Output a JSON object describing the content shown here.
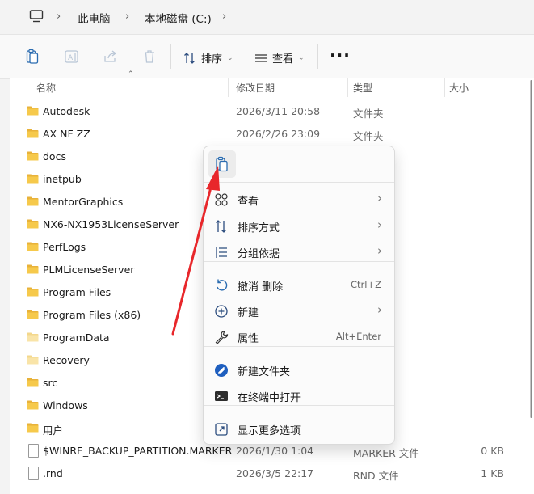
{
  "breadcrumb": {
    "items": [
      "此电脑",
      "本地磁盘 (C:)"
    ]
  },
  "toolbar": {
    "sort_label": "排序",
    "view_label": "查看",
    "more_label": "···"
  },
  "columns": {
    "name": "名称",
    "date": "修改日期",
    "type": "类型",
    "size": "大小"
  },
  "files": [
    {
      "name": "Autodesk",
      "date": "2026/3/11 20:58",
      "type": "文件夹",
      "size": "",
      "kind": "folder"
    },
    {
      "name": "AX NF ZZ",
      "date": "2026/2/26 23:09",
      "type": "文件夹",
      "size": "",
      "kind": "folder"
    },
    {
      "name": "docs",
      "date": "",
      "type": "",
      "size": "",
      "kind": "folder"
    },
    {
      "name": "inetpub",
      "date": "",
      "type": "",
      "size": "",
      "kind": "folder"
    },
    {
      "name": "MentorGraphics",
      "date": "",
      "type": "",
      "size": "",
      "kind": "folder"
    },
    {
      "name": "NX6-NX1953LicenseServer",
      "date": "",
      "type": "",
      "size": "",
      "kind": "folder"
    },
    {
      "name": "PerfLogs",
      "date": "",
      "type": "",
      "size": "",
      "kind": "folder"
    },
    {
      "name": "PLMLicenseServer",
      "date": "",
      "type": "",
      "size": "",
      "kind": "folder"
    },
    {
      "name": "Program Files",
      "date": "",
      "type": "",
      "size": "",
      "kind": "folder"
    },
    {
      "name": "Program Files (x86)",
      "date": "",
      "type": "",
      "size": "",
      "kind": "folder"
    },
    {
      "name": "ProgramData",
      "date": "",
      "type": "",
      "size": "",
      "kind": "folder-hidden"
    },
    {
      "name": "Recovery",
      "date": "",
      "type": "",
      "size": "",
      "kind": "folder-hidden"
    },
    {
      "name": "src",
      "date": "",
      "type": "",
      "size": "",
      "kind": "folder"
    },
    {
      "name": "Windows",
      "date": "",
      "type": "",
      "size": "",
      "kind": "folder"
    },
    {
      "name": "用户",
      "date": "",
      "type": "",
      "size": "",
      "kind": "folder"
    },
    {
      "name": "$WINRE_BACKUP_PARTITION.MARKER",
      "date": "2026/1/30 1:04",
      "type": "MARKER 文件",
      "size": "0 KB",
      "kind": "file"
    },
    {
      "name": ".rnd",
      "date": "2026/3/5 22:17",
      "type": "RND 文件",
      "size": "1 KB",
      "kind": "file"
    }
  ],
  "context_menu": {
    "items": [
      {
        "label": "查看",
        "shortcut": "",
        "submenu": true,
        "icon": "grid-icon"
      },
      {
        "label": "排序方式",
        "shortcut": "",
        "submenu": true,
        "icon": "sort-icon"
      },
      {
        "label": "分组依据",
        "shortcut": "",
        "submenu": true,
        "icon": "group-icon"
      },
      {
        "label": "撤消 删除",
        "shortcut": "Ctrl+Z",
        "submenu": false,
        "icon": "undo-icon"
      },
      {
        "label": "新建",
        "shortcut": "",
        "submenu": true,
        "icon": "new-icon"
      },
      {
        "label": "属性",
        "shortcut": "Alt+Enter",
        "submenu": false,
        "icon": "wrench-icon"
      },
      {
        "label": "新建文件夹",
        "shortcut": "",
        "submenu": false,
        "icon": "new-folder-icon"
      },
      {
        "label": "在终端中打开",
        "shortcut": "",
        "submenu": false,
        "icon": "terminal-icon"
      },
      {
        "label": "显示更多选项",
        "shortcut": "",
        "submenu": false,
        "icon": "more-options-icon"
      }
    ]
  },
  "colors": {
    "folder": "#f6c94b",
    "folder_dark": "#e8b23a",
    "annotation_arrow": "#e8272b",
    "accent": "#005fb8"
  }
}
